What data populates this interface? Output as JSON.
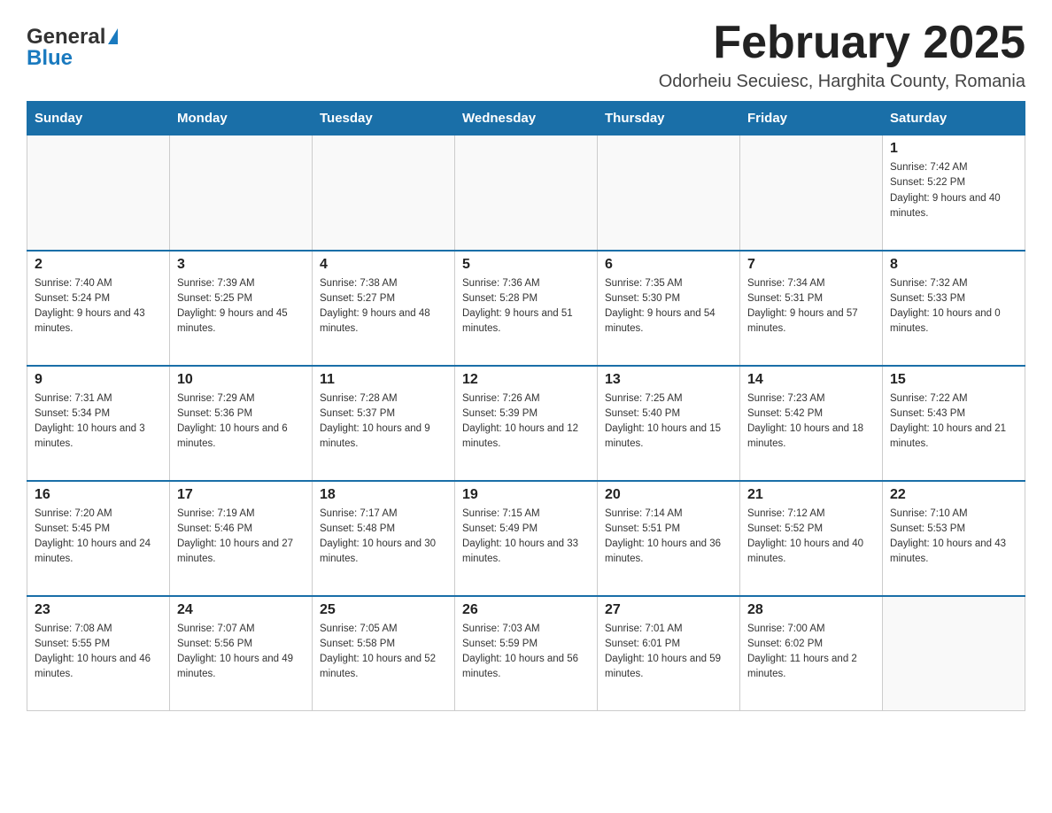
{
  "logo": {
    "text_general": "General",
    "text_blue": "Blue"
  },
  "header": {
    "title": "February 2025",
    "subtitle": "Odorheiu Secuiesc, Harghita County, Romania"
  },
  "weekdays": [
    "Sunday",
    "Monday",
    "Tuesday",
    "Wednesday",
    "Thursday",
    "Friday",
    "Saturday"
  ],
  "weeks": [
    [
      {
        "day": "",
        "info": ""
      },
      {
        "day": "",
        "info": ""
      },
      {
        "day": "",
        "info": ""
      },
      {
        "day": "",
        "info": ""
      },
      {
        "day": "",
        "info": ""
      },
      {
        "day": "",
        "info": ""
      },
      {
        "day": "1",
        "info": "Sunrise: 7:42 AM\nSunset: 5:22 PM\nDaylight: 9 hours and 40 minutes."
      }
    ],
    [
      {
        "day": "2",
        "info": "Sunrise: 7:40 AM\nSunset: 5:24 PM\nDaylight: 9 hours and 43 minutes."
      },
      {
        "day": "3",
        "info": "Sunrise: 7:39 AM\nSunset: 5:25 PM\nDaylight: 9 hours and 45 minutes."
      },
      {
        "day": "4",
        "info": "Sunrise: 7:38 AM\nSunset: 5:27 PM\nDaylight: 9 hours and 48 minutes."
      },
      {
        "day": "5",
        "info": "Sunrise: 7:36 AM\nSunset: 5:28 PM\nDaylight: 9 hours and 51 minutes."
      },
      {
        "day": "6",
        "info": "Sunrise: 7:35 AM\nSunset: 5:30 PM\nDaylight: 9 hours and 54 minutes."
      },
      {
        "day": "7",
        "info": "Sunrise: 7:34 AM\nSunset: 5:31 PM\nDaylight: 9 hours and 57 minutes."
      },
      {
        "day": "8",
        "info": "Sunrise: 7:32 AM\nSunset: 5:33 PM\nDaylight: 10 hours and 0 minutes."
      }
    ],
    [
      {
        "day": "9",
        "info": "Sunrise: 7:31 AM\nSunset: 5:34 PM\nDaylight: 10 hours and 3 minutes."
      },
      {
        "day": "10",
        "info": "Sunrise: 7:29 AM\nSunset: 5:36 PM\nDaylight: 10 hours and 6 minutes."
      },
      {
        "day": "11",
        "info": "Sunrise: 7:28 AM\nSunset: 5:37 PM\nDaylight: 10 hours and 9 minutes."
      },
      {
        "day": "12",
        "info": "Sunrise: 7:26 AM\nSunset: 5:39 PM\nDaylight: 10 hours and 12 minutes."
      },
      {
        "day": "13",
        "info": "Sunrise: 7:25 AM\nSunset: 5:40 PM\nDaylight: 10 hours and 15 minutes."
      },
      {
        "day": "14",
        "info": "Sunrise: 7:23 AM\nSunset: 5:42 PM\nDaylight: 10 hours and 18 minutes."
      },
      {
        "day": "15",
        "info": "Sunrise: 7:22 AM\nSunset: 5:43 PM\nDaylight: 10 hours and 21 minutes."
      }
    ],
    [
      {
        "day": "16",
        "info": "Sunrise: 7:20 AM\nSunset: 5:45 PM\nDaylight: 10 hours and 24 minutes."
      },
      {
        "day": "17",
        "info": "Sunrise: 7:19 AM\nSunset: 5:46 PM\nDaylight: 10 hours and 27 minutes."
      },
      {
        "day": "18",
        "info": "Sunrise: 7:17 AM\nSunset: 5:48 PM\nDaylight: 10 hours and 30 minutes."
      },
      {
        "day": "19",
        "info": "Sunrise: 7:15 AM\nSunset: 5:49 PM\nDaylight: 10 hours and 33 minutes."
      },
      {
        "day": "20",
        "info": "Sunrise: 7:14 AM\nSunset: 5:51 PM\nDaylight: 10 hours and 36 minutes."
      },
      {
        "day": "21",
        "info": "Sunrise: 7:12 AM\nSunset: 5:52 PM\nDaylight: 10 hours and 40 minutes."
      },
      {
        "day": "22",
        "info": "Sunrise: 7:10 AM\nSunset: 5:53 PM\nDaylight: 10 hours and 43 minutes."
      }
    ],
    [
      {
        "day": "23",
        "info": "Sunrise: 7:08 AM\nSunset: 5:55 PM\nDaylight: 10 hours and 46 minutes."
      },
      {
        "day": "24",
        "info": "Sunrise: 7:07 AM\nSunset: 5:56 PM\nDaylight: 10 hours and 49 minutes."
      },
      {
        "day": "25",
        "info": "Sunrise: 7:05 AM\nSunset: 5:58 PM\nDaylight: 10 hours and 52 minutes."
      },
      {
        "day": "26",
        "info": "Sunrise: 7:03 AM\nSunset: 5:59 PM\nDaylight: 10 hours and 56 minutes."
      },
      {
        "day": "27",
        "info": "Sunrise: 7:01 AM\nSunset: 6:01 PM\nDaylight: 10 hours and 59 minutes."
      },
      {
        "day": "28",
        "info": "Sunrise: 7:00 AM\nSunset: 6:02 PM\nDaylight: 11 hours and 2 minutes."
      },
      {
        "day": "",
        "info": ""
      }
    ]
  ]
}
